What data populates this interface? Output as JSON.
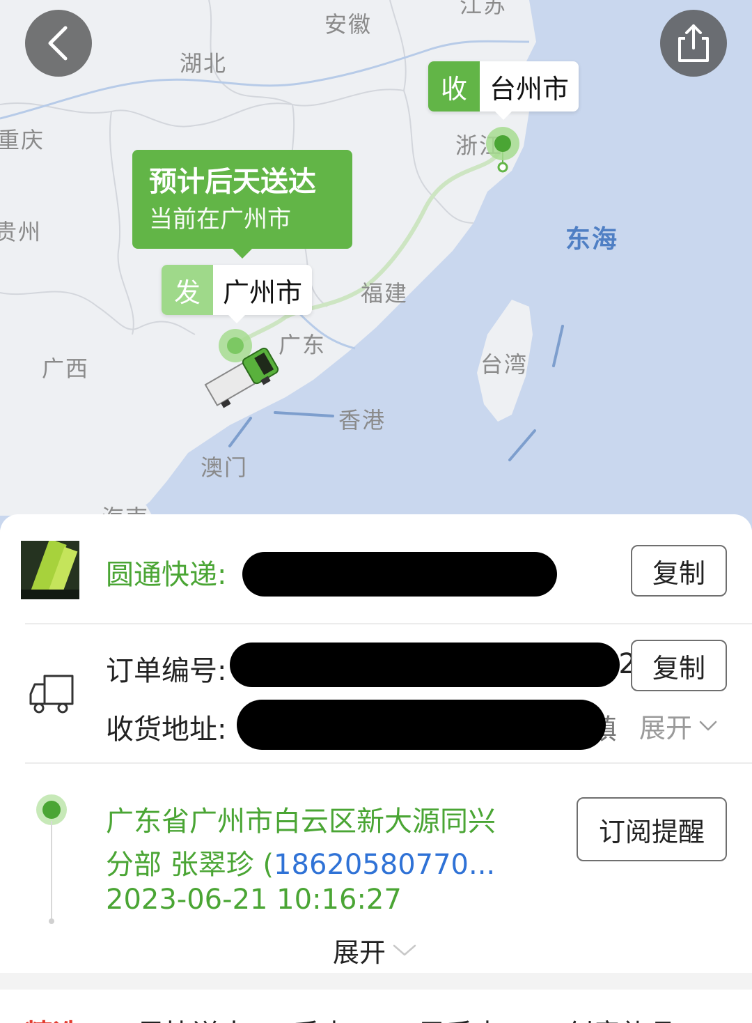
{
  "map": {
    "labels": {
      "jiangsu": "江苏",
      "anhui": "安徽",
      "hubei": "湖北",
      "chongqing": "重庆",
      "guizhou": "贵州",
      "zhejiang": "浙江",
      "fujian": "福建",
      "guangdong": "广东",
      "guangxi": "广西",
      "taiwan": "台湾",
      "hongkong": "香港",
      "macau": "澳门",
      "hainan": "海南",
      "east_sea": "东海"
    },
    "destination": {
      "key": "收",
      "city": "台州市"
    },
    "origin": {
      "key": "发",
      "city": "广州市"
    },
    "eta": {
      "title": "预计后天送达",
      "subtitle": "当前在广州市"
    },
    "colors": {
      "accent": "#62b547",
      "origin_key": "#9fd98a",
      "land": "#eef0f3",
      "sea": "#c9d7ee"
    }
  },
  "nav": {
    "back_icon": "chevron-left-icon",
    "share_icon": "share-icon"
  },
  "shipment": {
    "carrier_label": "圆通快递:",
    "copy_label": "复制",
    "order_label": "订单编号:",
    "order_suffix": "1872",
    "order_copy_label": "复制",
    "address_label": "收货地址:",
    "address_suffix": "镇",
    "address_expand": "展开"
  },
  "tracking": {
    "line1": "广东省广州市白云区新大源同兴",
    "line2_prefix": "分部 张翠珍 (",
    "phone": "18620580770...",
    "timestamp": "2023-06-21 10:16:27",
    "subscribe_label": "订阅提醒",
    "expand_label": "展开"
  },
  "footer": {
    "items": [
      "精选",
      "尽快送大",
      "手表",
      "男手表",
      "创意礼品"
    ]
  }
}
